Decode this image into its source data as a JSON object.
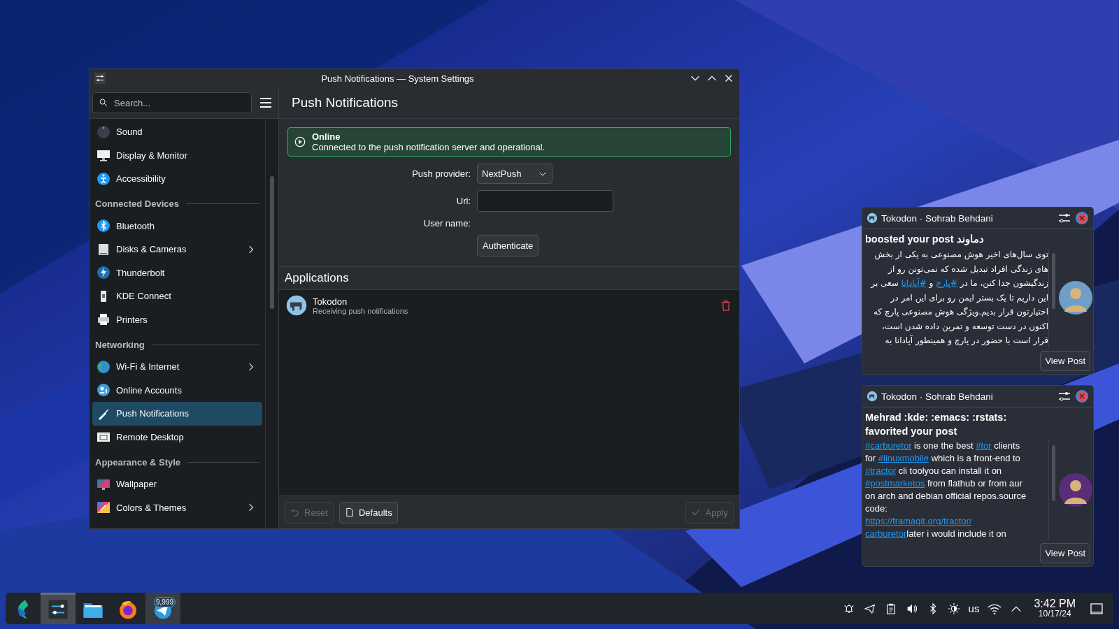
{
  "window": {
    "title": "Push Notifications — System Settings",
    "search": {
      "placeholder": "Search..."
    },
    "page_title": "Push Notifications",
    "sidebar": [
      {
        "kind": "item",
        "label": "Sound",
        "chevron": false,
        "selected": false
      },
      {
        "kind": "item",
        "label": "Display & Monitor",
        "chevron": false,
        "selected": false
      },
      {
        "kind": "item",
        "label": "Accessibility",
        "chevron": false,
        "selected": false
      },
      {
        "kind": "header",
        "label": "Connected Devices"
      },
      {
        "kind": "item",
        "label": "Bluetooth",
        "chevron": false,
        "selected": false
      },
      {
        "kind": "item",
        "label": "Disks & Cameras",
        "chevron": true,
        "selected": false
      },
      {
        "kind": "item",
        "label": "Thunderbolt",
        "chevron": false,
        "selected": false
      },
      {
        "kind": "item",
        "label": "KDE Connect",
        "chevron": false,
        "selected": false
      },
      {
        "kind": "item",
        "label": "Printers",
        "chevron": false,
        "selected": false
      },
      {
        "kind": "header",
        "label": "Networking"
      },
      {
        "kind": "item",
        "label": "Wi-Fi & Internet",
        "chevron": true,
        "selected": false
      },
      {
        "kind": "item",
        "label": "Online Accounts",
        "chevron": false,
        "selected": false
      },
      {
        "kind": "item",
        "label": "Push Notifications",
        "chevron": false,
        "selected": true
      },
      {
        "kind": "item",
        "label": "Remote Desktop",
        "chevron": false,
        "selected": false
      },
      {
        "kind": "header",
        "label": "Appearance & Style"
      },
      {
        "kind": "item",
        "label": "Wallpaper",
        "chevron": false,
        "selected": false
      },
      {
        "kind": "item",
        "label": "Colors & Themes",
        "chevron": true,
        "selected": false
      }
    ],
    "status": {
      "title": "Online",
      "message": "Connected to the push notification server and operational."
    },
    "form": {
      "provider_label": "Push provider:",
      "provider": "NextPush",
      "url_label": "Url:",
      "user_label": "User name:",
      "auth_button": "Authenticate"
    },
    "applications": {
      "title": "Applications",
      "items": [
        {
          "name": "Tokodon",
          "status": "Receiving push notifications"
        }
      ]
    },
    "footer": {
      "reset": {
        "label": "Reset",
        "disabled": true
      },
      "defaults": {
        "label": "Defaults",
        "disabled": false
      },
      "apply": {
        "label": "Apply",
        "disabled": true
      }
    }
  },
  "notifications": [
    {
      "kind": "rtl",
      "app": "Tokodon · Sohrab Behdani",
      "title": "boosted your post دماوند",
      "button": "View Post",
      "lines": [
        [
          {
            "text": "توی سال‌های اخیر هوش مصنوعی به یکی از بخش",
            "link": false
          }
        ],
        [
          {
            "text": "های زندگی افراد تبدیل شده که نمی‌تونن رو از",
            "link": false
          }
        ],
        [
          {
            "text": "زندگیشون جدا کنن، ما در ",
            "link": false
          },
          {
            "text": "#پارچ",
            "link": true
          },
          {
            "text": " و ",
            "link": false
          },
          {
            "text": "#آپادانا",
            "link": true
          },
          {
            "text": " سعی بر",
            "link": false
          }
        ],
        [
          {
            "text": "این داریم تا یک بستر ایمن رو برای این امر در",
            "link": false
          }
        ],
        [
          {
            "text": "اختیارتون قرار بدیم.ویژگی هوش مصنوعی پارچ که",
            "link": false
          }
        ],
        [
          {
            "text": "اکنون در دست توسعه و تمرین داده شدن است،",
            "link": false
          }
        ],
        [
          {
            "text": "قرار است با حضور در پارچ و همینطور آپادانا به",
            "link": false
          }
        ]
      ]
    },
    {
      "kind": "ltr",
      "app": "Tokodon · Sohrab Behdani",
      "title": "Mehrad :kde: :emacs: :rstats: favorited your post",
      "button": "View Post",
      "lines": [
        [
          {
            "text": "#carburetor",
            "link": true
          },
          {
            "text": " is one the best ",
            "link": false
          },
          {
            "text": "#tor",
            "link": true
          },
          {
            "text": " clients",
            "link": false
          }
        ],
        [
          {
            "text": "for ",
            "link": false
          },
          {
            "text": "#linuxmobile",
            "link": true
          },
          {
            "text": " which is a front-end to",
            "link": false
          }
        ],
        [
          {
            "text": "#tractor",
            "link": true
          },
          {
            "text": " cli toolyou can install it on",
            "link": false
          }
        ],
        [
          {
            "text": "#postmarketos",
            "link": true
          },
          {
            "text": " from flathub or from aur",
            "link": false
          }
        ],
        [
          {
            "text": "on arch and debian official repos.source",
            "link": false
          }
        ],
        [
          {
            "text": "code:",
            "link": false
          }
        ],
        [
          {
            "text": "https://framagit.org/tractor/",
            "link": true
          }
        ],
        [
          {
            "text": "carburetor",
            "link": true
          },
          {
            "text": "later i would include it on",
            "link": false
          }
        ]
      ]
    }
  ],
  "taskbar": {
    "apps": [
      {
        "open": false,
        "selected": false
      },
      {
        "open": true,
        "selected": true
      },
      {
        "open": false,
        "selected": false
      },
      {
        "open": false,
        "selected": false
      },
      {
        "open": true,
        "selected": false,
        "badge": "9,999"
      }
    ],
    "keyboard": "us",
    "time": "3:42 PM",
    "date": "10/17/24"
  }
}
